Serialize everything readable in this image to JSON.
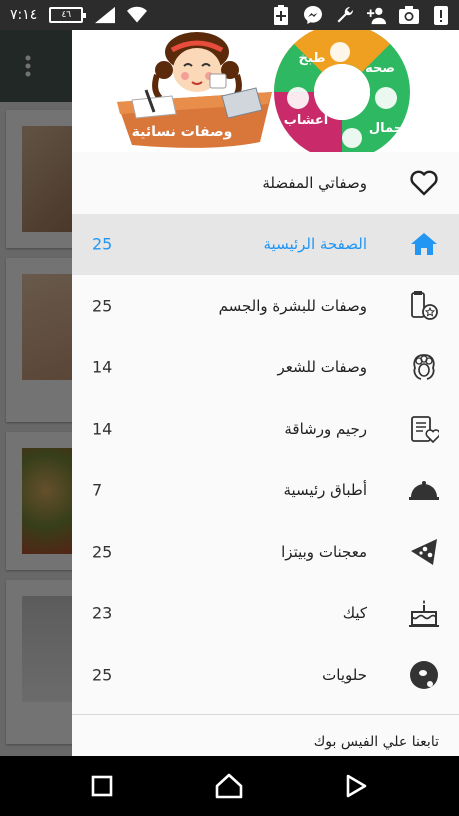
{
  "status_bar": {
    "time": "٧:١٤",
    "battery": "٤٦",
    "icons": [
      "signal-icon",
      "wifi-icon",
      "add-notification-icon",
      "messenger-icon",
      "wrench-icon",
      "add-user-icon",
      "camera-icon",
      "alert-icon"
    ]
  },
  "drawer": {
    "header_logo_text": "وصفات نسائية",
    "circle_labels": [
      "طبخ",
      "صحه",
      "جمال",
      "اعشاب"
    ],
    "items": [
      {
        "label": "وصفاتي المفضلة",
        "count": "",
        "icon": "heart-icon",
        "active": false
      },
      {
        "label": "الصفحة الرئيسية",
        "count": "25",
        "icon": "home-icon",
        "active": true
      },
      {
        "label": "وصفات للبشرة والجسم",
        "count": "25",
        "icon": "skincare-icon",
        "active": false
      },
      {
        "label": "وصفات للشعر",
        "count": "14",
        "icon": "hair-icon",
        "active": false
      },
      {
        "label": "رجيم ورشاقة",
        "count": "14",
        "icon": "diet-icon",
        "active": false
      },
      {
        "label": "أطباق رئيسية",
        "count": "7",
        "icon": "dish-cover-icon",
        "active": false
      },
      {
        "label": "معجنات وبيتزا",
        "count": "25",
        "icon": "pizza-icon",
        "active": false
      },
      {
        "label": "كيك",
        "count": "23",
        "icon": "cake-icon",
        "active": false
      },
      {
        "label": "حلويات",
        "count": "25",
        "icon": "donut-icon",
        "active": false
      }
    ],
    "follow_text": "تابعنا علي الفيس بوك"
  },
  "colors": {
    "accent": "#2196f3",
    "active_bg": "#e6e6e6"
  }
}
